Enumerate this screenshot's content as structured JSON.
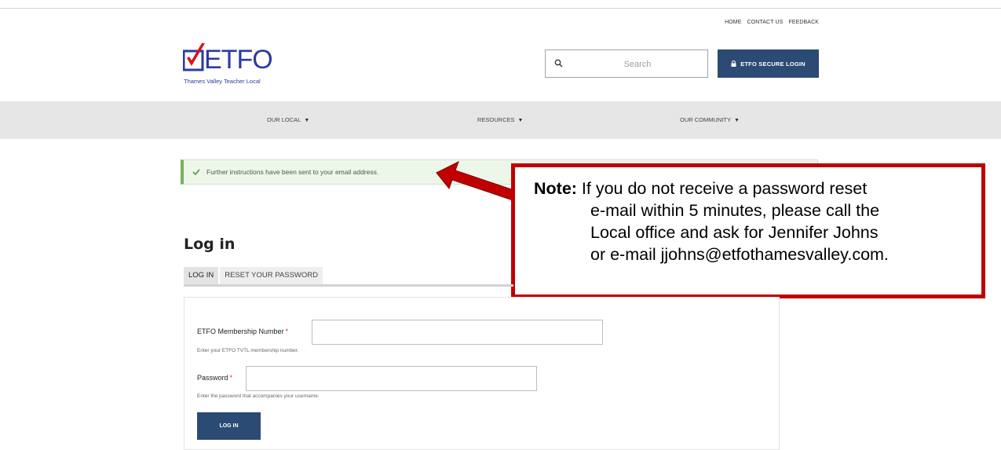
{
  "utility_nav": [
    "HOME",
    "CONTACT US",
    "FEEDBACK"
  ],
  "logo": {
    "text": "ETFO",
    "subtitle": "Thames Valley Teacher Local"
  },
  "search": {
    "placeholder": "Search",
    "icon": "search-icon"
  },
  "secure_login": {
    "label": "ETFO SECURE LOGIN",
    "icon": "lock-icon"
  },
  "main_nav": [
    {
      "label": "OUR LOCAL"
    },
    {
      "label": "RESOURCES"
    },
    {
      "label": "OUR COMMUNITY"
    }
  ],
  "status_message": "Further instructions have been sent to your email address.",
  "note": {
    "label": "Note:",
    "line1": "If you do not receive a password reset",
    "line2": "e-mail within 5 minutes, please call the",
    "line3": "Local office and ask for Jennifer Johns",
    "line4": "or e-mail jjohns@etfothamesvalley.com."
  },
  "page_title": "Log in",
  "tabs": [
    {
      "label": "LOG IN",
      "active": true
    },
    {
      "label": "RESET YOUR PASSWORD",
      "active": false
    }
  ],
  "form": {
    "membership": {
      "label": "ETFO Membership Number",
      "required_mark": "*",
      "help": "Enter your ETFO TVTL membership number.",
      "value": ""
    },
    "password": {
      "label": "Password",
      "required_mark": "*",
      "help": "Enter the password that accompanies your username.",
      "value": ""
    },
    "submit_label": "LOG IN"
  },
  "colors": {
    "brand_blue": "#2b4a74",
    "logo_blue": "#2b3aa6",
    "logo_red": "#d8141c",
    "alert_green": "#73b35b",
    "note_border": "#c00000",
    "nav_bg": "#e6e6e6"
  }
}
